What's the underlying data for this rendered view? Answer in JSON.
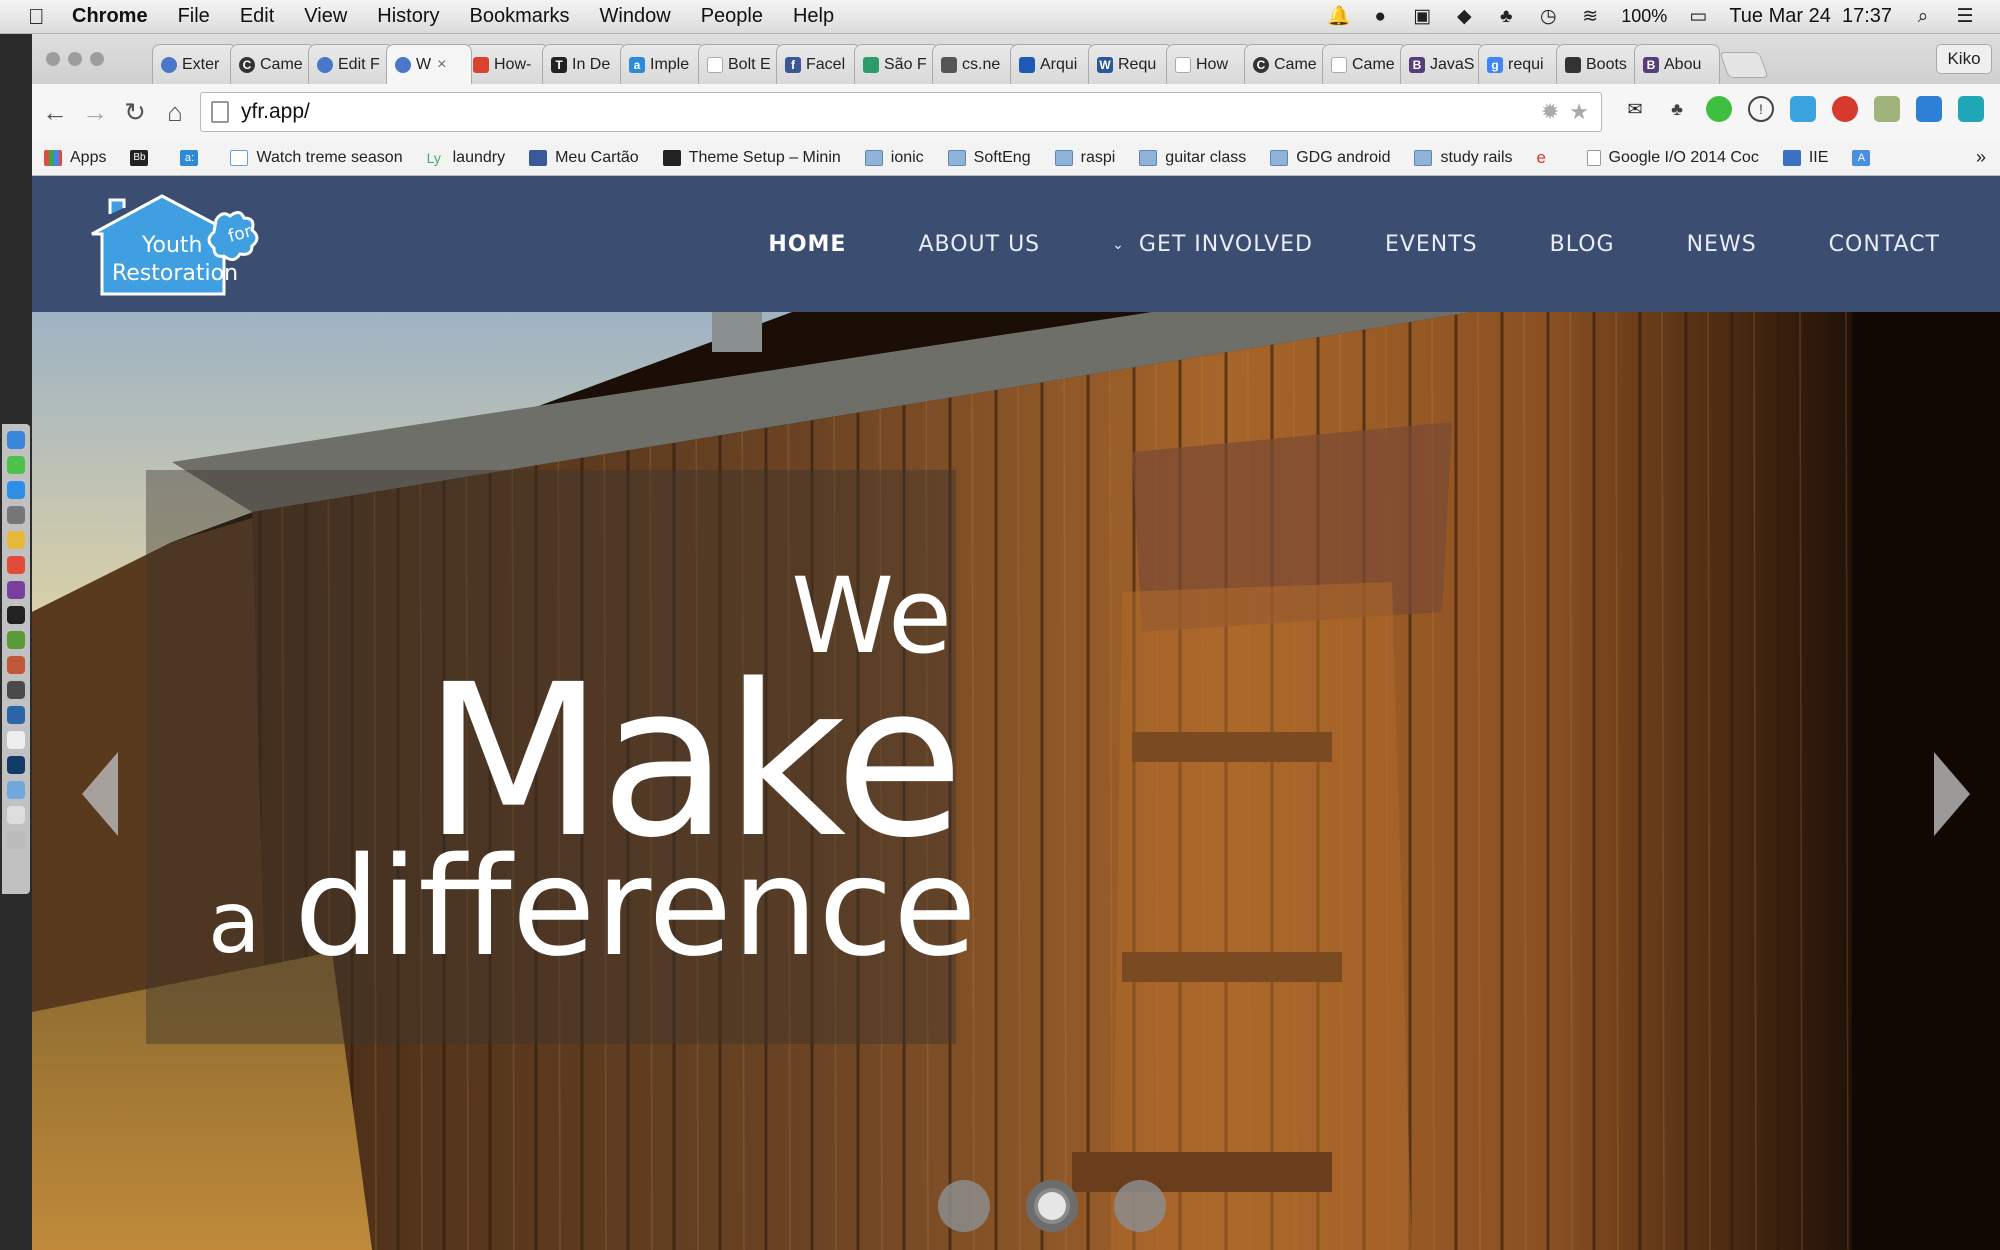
{
  "menubar": {
    "app_name": "Chrome",
    "items": [
      "File",
      "Edit",
      "View",
      "History",
      "Bookmarks",
      "Window",
      "People",
      "Help"
    ],
    "battery": "100%",
    "clock": "Tue Mar 24  17:37"
  },
  "browser": {
    "tabs": [
      {
        "label": "Exter",
        "icon": "chrome-icon",
        "color": "#4a77c9"
      },
      {
        "label": "Came",
        "icon": "c-icon",
        "color": "#333333"
      },
      {
        "label": "Edit F",
        "icon": "chrome-icon",
        "color": "#4a77c9"
      },
      {
        "label": "W",
        "icon": "chrome-icon",
        "color": "#4a77c9",
        "active": true
      },
      {
        "label": "How-",
        "icon": "red-icon",
        "color": "#d9432f"
      },
      {
        "label": "In De",
        "icon": "nyt-icon",
        "color": "#222222"
      },
      {
        "label": "Imple",
        "icon": "a-icon",
        "color": "#2c8ad6"
      },
      {
        "label": "Bolt E",
        "icon": "page-icon",
        "color": "#cfcfcf"
      },
      {
        "label": "Facel",
        "icon": "facebook-icon",
        "color": "#3b5998"
      },
      {
        "label": "São F",
        "icon": "bike-icon",
        "color": "#2e9c6a"
      },
      {
        "label": "cs.ne",
        "icon": "hat-icon",
        "color": "#555555"
      },
      {
        "label": "Arqui",
        "icon": "cloud-icon",
        "color": "#1e5bb8"
      },
      {
        "label": "Requ",
        "icon": "word-icon",
        "color": "#2b579a"
      },
      {
        "label": "How",
        "icon": "page-icon",
        "color": "#cfcfcf"
      },
      {
        "label": "Came",
        "icon": "c-icon",
        "color": "#333333"
      },
      {
        "label": "Came",
        "icon": "page-icon",
        "color": "#cfcfcf"
      },
      {
        "label": "JavaS",
        "icon": "bootstrap-icon",
        "color": "#563d7c"
      },
      {
        "label": "requi",
        "icon": "google-icon",
        "color": "#4285f4"
      },
      {
        "label": "Boots",
        "icon": "bolt-icon",
        "color": "#333333"
      },
      {
        "label": "Abou",
        "icon": "bootstrap-icon",
        "color": "#563d7c"
      }
    ],
    "active_tab_close": "×",
    "profile": "Kiko",
    "url": "yfr.app/",
    "bookmarks": [
      {
        "label": "Apps",
        "type": "apps"
      },
      {
        "label": "Bb",
        "type": "bb"
      },
      {
        "label": "a:",
        "type": "a"
      },
      {
        "label": "Watch treme season",
        "type": "page"
      },
      {
        "label": "laundry",
        "type": "ly"
      },
      {
        "label": "Meu Cartão",
        "type": "facebook"
      },
      {
        "label": "Theme Setup – Minin",
        "type": "page"
      },
      {
        "label": "ionic",
        "type": "folder"
      },
      {
        "label": "SoftEng",
        "type": "folder"
      },
      {
        "label": "raspi",
        "type": "folder"
      },
      {
        "label": "guitar class",
        "type": "folder"
      },
      {
        "label": "GDG android",
        "type": "folder"
      },
      {
        "label": "study rails",
        "type": "folder"
      },
      {
        "label": "e",
        "type": "e"
      },
      {
        "label": "Google I/O 2014 Coc",
        "type": "page"
      },
      {
        "label": "IIE",
        "type": "iie"
      },
      {
        "label": "A",
        "type": "translate"
      }
    ],
    "bookmarks_overflow": "»"
  },
  "site": {
    "logo_line1": "Youth",
    "logo_for": "for",
    "logo_line2": "Restoration",
    "nav": [
      {
        "label": "HOME",
        "active": true
      },
      {
        "label": "ABOUT US"
      },
      {
        "label": "GET INVOLVED",
        "has_dropdown": true
      },
      {
        "label": "EVENTS"
      },
      {
        "label": "BLOG"
      },
      {
        "label": "NEWS"
      },
      {
        "label": "CONTACT"
      }
    ],
    "hero": {
      "line_we": "We",
      "line_make": "Make",
      "line_a": "a",
      "line_difference": "difference",
      "slides_total": 3,
      "active_slide": 2
    },
    "colors": {
      "header_bg": "#3b4e72",
      "logo_blue": "#3f9fe0"
    }
  }
}
